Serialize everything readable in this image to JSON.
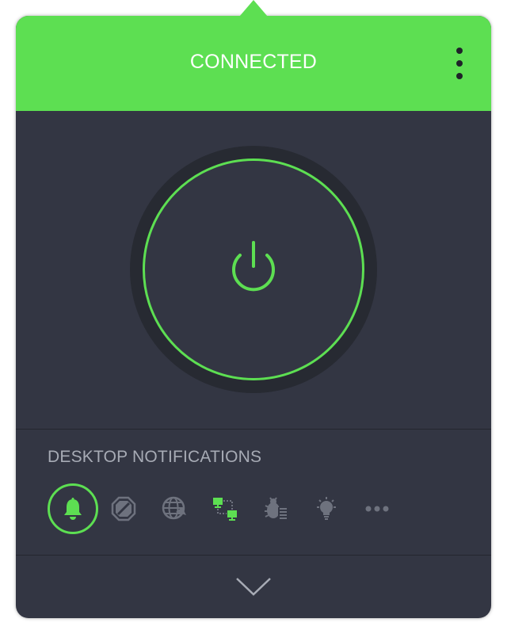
{
  "header": {
    "status": "CONNECTED",
    "menu_icon": "vertical-dots-icon"
  },
  "colors": {
    "accent": "#5ddf52",
    "background": "#333643",
    "ring": "#272a32",
    "muted_text": "#a7abb5",
    "icon_inactive": "#6e727e"
  },
  "main": {
    "power_icon": "power-icon",
    "connected": true
  },
  "notifications": {
    "title": "DESKTOP NOTIFICATIONS",
    "icons": [
      {
        "name": "bell-icon",
        "active": true
      },
      {
        "name": "block-icon",
        "active": false
      },
      {
        "name": "globe-icon",
        "active": false
      },
      {
        "name": "network-icon",
        "active": false
      },
      {
        "name": "bug-icon",
        "active": false
      },
      {
        "name": "lightbulb-icon",
        "active": false
      },
      {
        "name": "more-icon",
        "active": false
      }
    ]
  },
  "footer": {
    "expand_icon": "chevron-down-icon"
  }
}
